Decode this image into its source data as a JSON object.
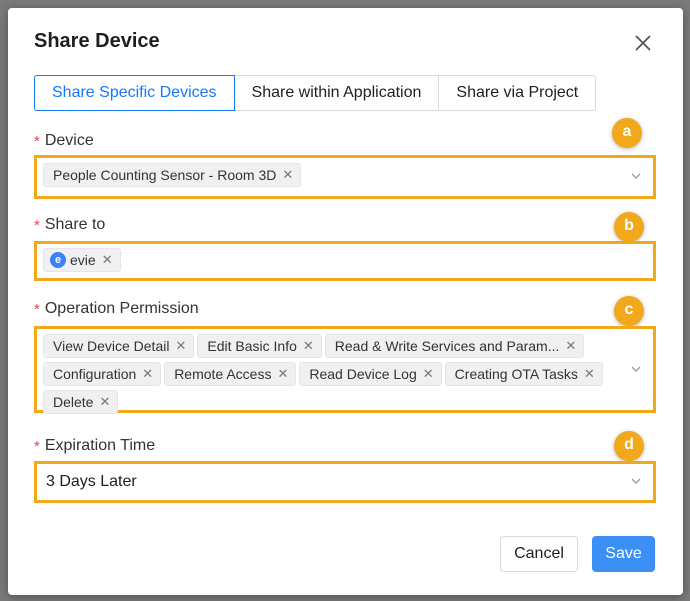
{
  "dialog": {
    "title": "Share Device",
    "tabs": [
      {
        "label": "Share Specific Devices",
        "active": true
      },
      {
        "label": "Share within Application",
        "active": false
      },
      {
        "label": "Share via Project",
        "active": false
      }
    ]
  },
  "device": {
    "label": "Device",
    "badge": "a",
    "tags": [
      "People Counting Sensor - Room 3D"
    ]
  },
  "share_to": {
    "label": "Share to",
    "badge": "b",
    "users": [
      {
        "initial": "e",
        "name": "evie"
      }
    ]
  },
  "permission": {
    "label": "Operation Permission",
    "badge": "c",
    "tags": [
      "View Device Detail",
      "Edit Basic Info",
      "Read & Write Services and Param...",
      "Configuration",
      "Remote Access",
      "Read Device Log",
      "Creating OTA Tasks",
      "Delete"
    ]
  },
  "expiration": {
    "label": "Expiration Time",
    "badge": "d",
    "value": "3 Days Later"
  },
  "footer": {
    "cancel_label": "Cancel",
    "save_label": "Save"
  },
  "colors": {
    "highlight": "#f1a81b",
    "primary": "#1677ff",
    "required": "#e5484d"
  },
  "icons": {
    "close": "close-icon",
    "tag_remove": "remove-tag-icon",
    "dropdown": "chevron-down-icon"
  }
}
